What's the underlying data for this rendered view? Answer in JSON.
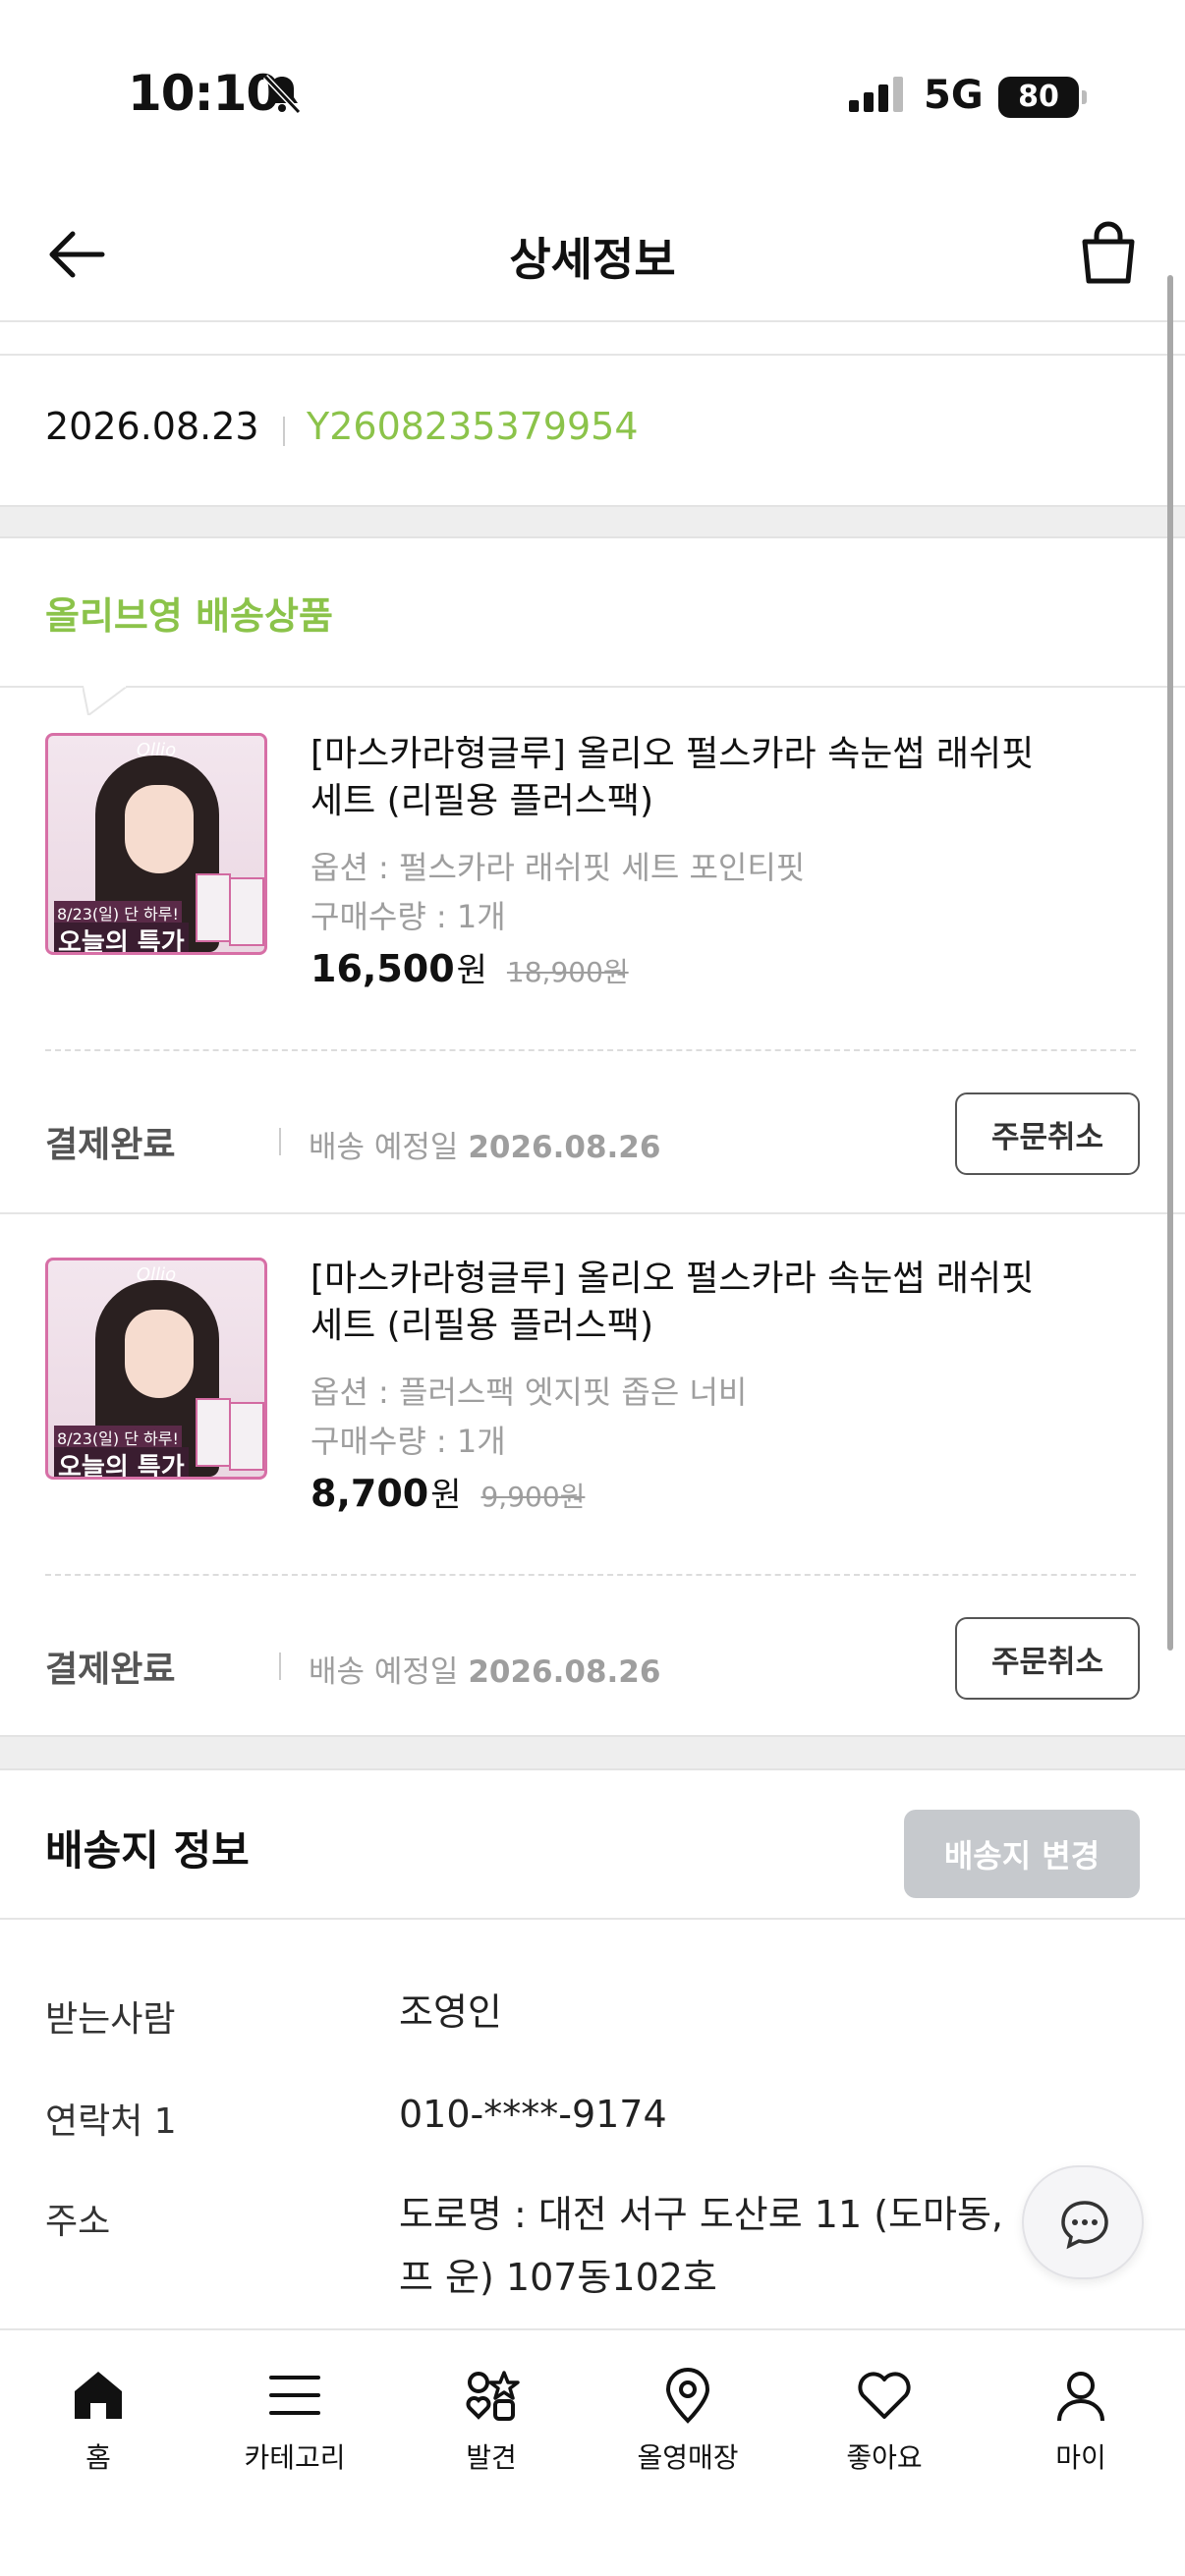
{
  "status_bar": {
    "time": "10:10",
    "network": "5G",
    "battery": "80"
  },
  "header": {
    "title": "상세정보"
  },
  "order": {
    "date": "2026.08.23",
    "number": "Y2608235379954"
  },
  "section_title": "올리브영 배송상품",
  "products": [
    {
      "name": "[마스카라형글루] 올리오 펄스카라 속눈썹 래쉬핏 세트 (리필용 플러스팩)",
      "option": "옵션 : 펄스카라 래쉬핏 세트 포인티핏",
      "quantity": "구매수량 : 1개",
      "price": "16,500",
      "price_unit": "원",
      "original_price": "18,900원",
      "thumb_brand": "Ollio",
      "thumb_promo_small": "8/23(일) 단 하루!",
      "thumb_promo_big": "오늘의 특가",
      "status": "결제완료",
      "delivery_label": "배송 예정일",
      "delivery_date": "2026.08.26",
      "cancel_label": "주문취소"
    },
    {
      "name": "[마스카라형글루] 올리오 펄스카라 속눈썹 래쉬핏 세트 (리필용 플러스팩)",
      "option": "옵션 : 플러스팩 엣지핏 좁은 너비",
      "quantity": "구매수량 : 1개",
      "price": "8,700",
      "price_unit": "원",
      "original_price": "9,900원",
      "thumb_brand": "Ollio",
      "thumb_promo_small": "8/23(일) 단 하루!",
      "thumb_promo_big": "오늘의 특가",
      "status": "결제완료",
      "delivery_label": "배송 예정일",
      "delivery_date": "2026.08.26",
      "cancel_label": "주문취소"
    }
  ],
  "shipping": {
    "title": "배송지 정보",
    "change_button": "배송지 변경",
    "receiver_label": "받는사람",
    "receiver": "조영인",
    "phone_label": "연락처 1",
    "phone": "010-****-9174",
    "address_label": "주소",
    "address": "도로명 : 대전 서구 도산로 11 (도마동, 프 운) 107동102호"
  },
  "bottom_nav": {
    "home": "홈",
    "category": "카테고리",
    "discover": "발견",
    "store": "올영매장",
    "likes": "좋아요",
    "my": "마이"
  },
  "icons": [
    "back-arrow-icon",
    "shopping-bag-icon",
    "chat-icon",
    "home-icon",
    "menu-icon",
    "discover-icon",
    "location-pin-icon",
    "heart-icon",
    "person-icon",
    "bell-muted-icon",
    "signal-icon"
  ],
  "colors": {
    "accent_green": "#8bc34a",
    "thumb_border": "#d76fa6",
    "disabled_button": "#c6c9cd"
  }
}
